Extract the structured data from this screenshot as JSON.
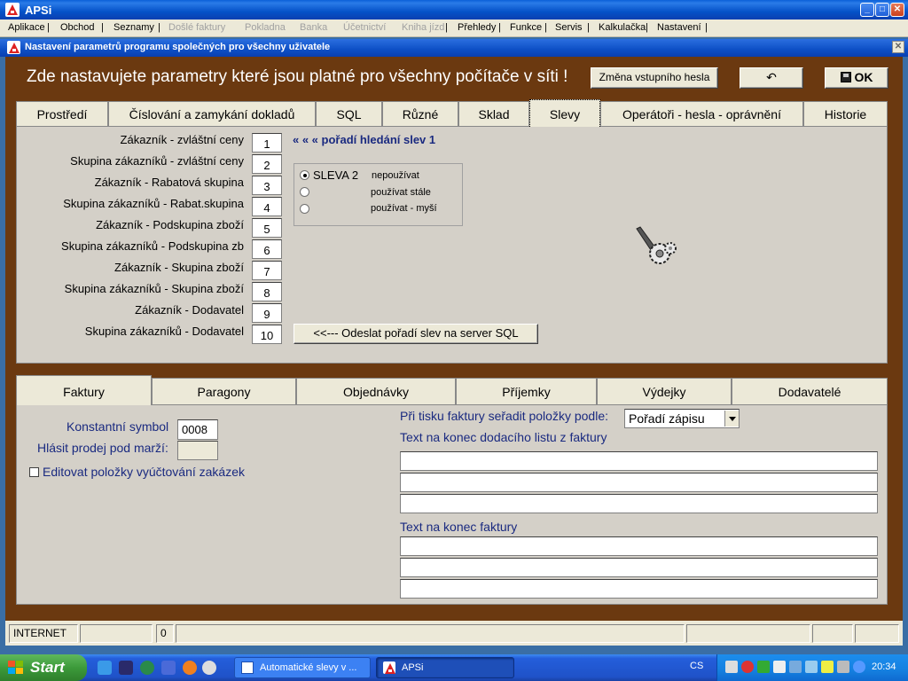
{
  "app": {
    "title": "APSi",
    "min": "_",
    "max": "□",
    "close": "✕"
  },
  "menu": [
    {
      "label": "Aplikace"
    },
    {
      "label": "Obchod"
    },
    {
      "label": "Seznamy"
    },
    {
      "label": "Došlé faktury"
    },
    {
      "label": "Pokladna"
    },
    {
      "label": "Banka"
    },
    {
      "label": "Účetnictví"
    },
    {
      "label": "Kniha jízd"
    },
    {
      "label": "Přehledy"
    },
    {
      "label": "Funkce"
    },
    {
      "label": "Servis"
    },
    {
      "label": "Kalkulačka"
    },
    {
      "label": "Nastavení"
    }
  ],
  "dialog": {
    "title": "Nastavení parametrů programu společných pro všechny uživatele",
    "close": "✕",
    "banner": "Zde nastavujete parametry které jsou platné pro všechny počítače v síti !",
    "change_password": "Změna vstupního hesla",
    "undo": "↶",
    "ok": "OK"
  },
  "top_tabs": [
    "Prostředí",
    "Číslování a zamykání dokladů",
    "SQL",
    "Různé",
    "Sklad",
    "Slevy",
    "Operátoři - hesla - oprávnění",
    "Historie"
  ],
  "discounts": {
    "title": "« «  «  pořadí hledání slev 1",
    "rows": [
      {
        "label": "Zákazník - zvláštní ceny",
        "order": "1"
      },
      {
        "label": "Skupina zákazníků - zvláštní ceny",
        "order": "2"
      },
      {
        "label": "Zákazník - Rabatová skupina",
        "order": "3"
      },
      {
        "label": "Skupina zákazníků - Rabat.skupina",
        "order": "4"
      },
      {
        "label": "Zákazník - Podskupina zboží",
        "order": "5"
      },
      {
        "label": "Skupina zákazníků - Podskupina zb",
        "order": "6"
      },
      {
        "label": "Zákazník - Skupina zboží",
        "order": "7"
      },
      {
        "label": "Skupina zákazníků - Skupina zboží",
        "order": "8"
      },
      {
        "label": "Zákazník - Dodavatel",
        "order": "9"
      },
      {
        "label": "Skupina zákazníků - Dodavatel",
        "order": "10"
      }
    ],
    "sleva2": {
      "name": "SLEVA 2",
      "options": [
        "nepoužívat",
        "používat stále",
        "používat - myší"
      ],
      "selected": "nepoužívat"
    },
    "send_button": "<<--- Odeslat pořadí slev na server SQL"
  },
  "bottom_tabs": [
    "Faktury",
    "Paragony",
    "Objednávky",
    "Příjemky",
    "Výdejky",
    "Dodavatelé"
  ],
  "invoice": {
    "constant_symbol_label": "Konstantní symbol",
    "constant_symbol_value": "0008",
    "report_label": "Hlásit prodej pod marží:",
    "report_value": "",
    "edit_items_label": "Editovat  položky vyúčtování zakázek",
    "sort_label": "Při tisku faktury seřadit položky podle:",
    "sort_value": "Pořadí zápisu",
    "delivery_text_label": "Text na konec dodacího listu z faktury",
    "invoice_text_label": "Text na konec faktury"
  },
  "statusbar": {
    "connection": "INTERNET",
    "count": "0"
  },
  "taskbar": {
    "start": "Start",
    "tasks": [
      {
        "label": "Automatické slevy v ..."
      },
      {
        "label": "APSi"
      }
    ],
    "lang": "CS",
    "time": "20:34"
  },
  "colors": {
    "dialog_bg": "#6b3910",
    "panel_bg": "#d4d0c8",
    "label_blue": "#1a2a80",
    "titlebar_blue": "#0a4fc5"
  }
}
